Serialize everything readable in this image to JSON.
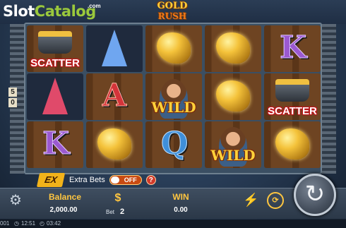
{
  "watermark": {
    "brand_main": "Slot",
    "brand_accent": "Catalog",
    "brand_suffix": ".com"
  },
  "game_logo": {
    "line1": "GOLD",
    "line2": "RUSH"
  },
  "reel_numbers": [
    "5",
    "0"
  ],
  "symbols": {
    "scatter_label": "SCATTER",
    "wild_label": "WILD",
    "letter_k": "K",
    "letter_a": "A",
    "letter_q": "Q"
  },
  "extra_bets": {
    "badge": "EX",
    "label": "Extra Bets",
    "toggle_state": "OFF",
    "help": "?"
  },
  "bottom_bar": {
    "balance_label": "Balance",
    "balance_value": "2,000.00",
    "bet_icon": "$",
    "bet_label": "Bet",
    "bet_value": "2",
    "win_label": "WIN",
    "win_value": "0.00"
  },
  "status_bar": {
    "left_fragment": "001",
    "clock": "12:51",
    "timer": "03:42"
  },
  "icons": {
    "settings": "gear-icon",
    "bet": "dollar-icon",
    "turbo": "lightning-icon",
    "autoplay": "autoplay-icon",
    "spin": "spin-arrow-icon"
  },
  "colors": {
    "accent_gold": "#ffc640",
    "scatter_red": "#c0151b",
    "wild_yellow": "#ffd23a",
    "brand_green": "#9bc93c"
  }
}
